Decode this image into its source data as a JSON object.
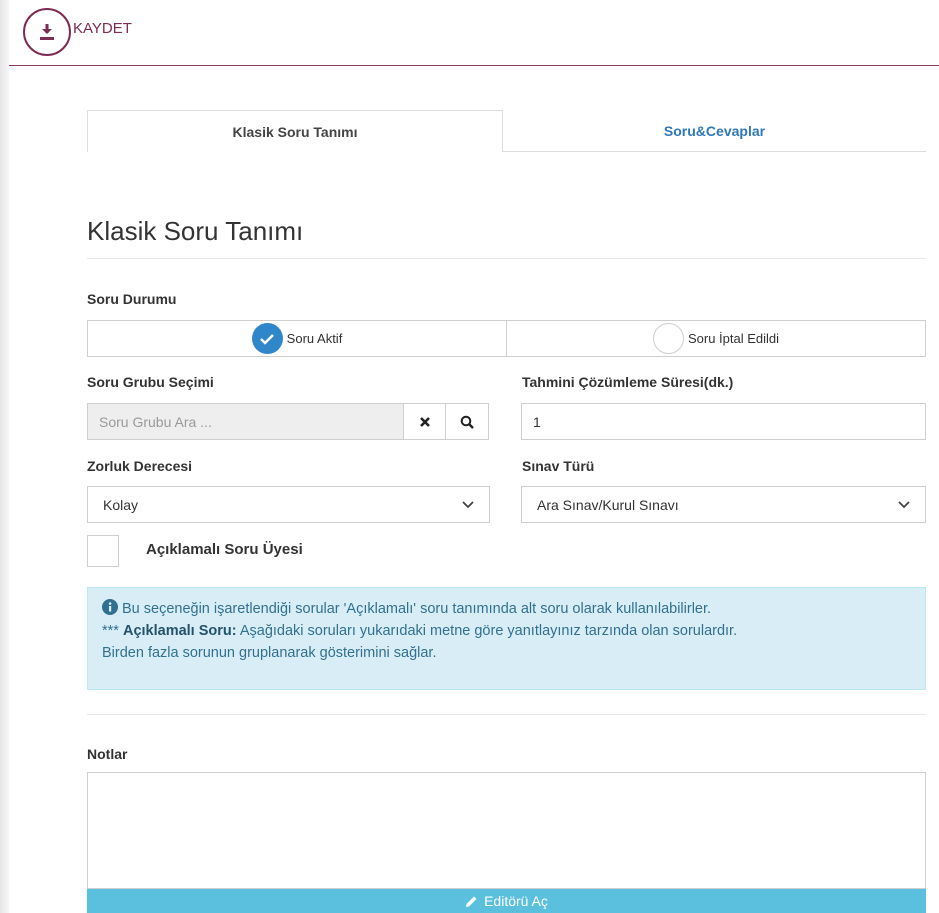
{
  "toolbar": {
    "save_label": "KAYDET",
    "save_icon": "download-icon"
  },
  "tabs": [
    {
      "label": "Klasik Soru Tanımı",
      "active": true
    },
    {
      "label": "Soru&Cevaplar",
      "active": false
    }
  ],
  "page_title": "Klasik Soru Tanımı",
  "status": {
    "label": "Soru Durumu",
    "options": [
      {
        "label": "Soru Aktif",
        "selected": true
      },
      {
        "label": "Soru İptal Edildi",
        "selected": false
      }
    ]
  },
  "group": {
    "label": "Soru Grubu Seçimi",
    "placeholder": "Soru Grubu Ara ..."
  },
  "duration": {
    "label": "Tahmini Çözümleme Süresi(dk.)",
    "value": "1"
  },
  "difficulty": {
    "label": "Zorluk Derecesi",
    "value": "Kolay"
  },
  "exam_type": {
    "label": "Sınav Türü",
    "value": "Ara Sınav/Kurul Sınavı"
  },
  "member_checkbox": {
    "label": "Açıklamalı Soru Üyesi",
    "checked": false
  },
  "info": {
    "line1": "Bu seçeneğin işaretlendiği sorular 'Açıklamalı' soru tanımında alt soru olarak kullanılabilirler.",
    "line2_prefix": "***",
    "line2_bold": "Açıklamalı Soru:",
    "line2_rest": "Aşağıdaki soruları yukarıdaki metne göre yanıtlayınız tarzında olan sorulardır.",
    "line3": "Birden fazla sorunun gruplanarak gösterimini sağlar."
  },
  "notes": {
    "label": "Notlar",
    "editor_button": "Editörü Aç"
  },
  "colors": {
    "brand": "#7d2c54",
    "tab_link": "#2f78b7",
    "radio_active": "#2f86c9",
    "info_bg": "#d9edf7",
    "editor_bar": "#5bc0de"
  }
}
